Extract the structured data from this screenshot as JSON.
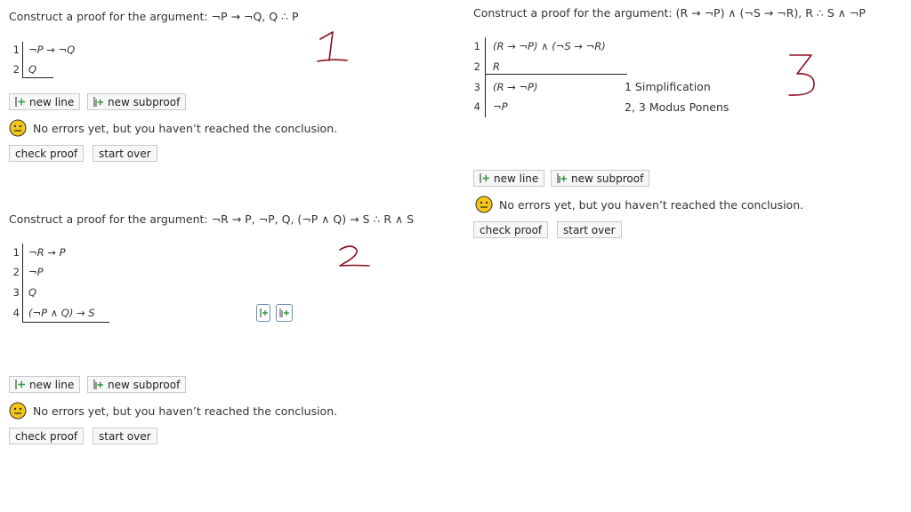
{
  "icons": {
    "new_line": "new-line-icon",
    "new_subproof": "new-subproof-icon",
    "status": "neutral-face-icon"
  },
  "colors": {
    "handwriting": "#8b0f1e",
    "face": "#f5c518",
    "insert_green": "#2e9a3c"
  },
  "problems": [
    {
      "prompt": "Construct a proof for the argument: ¬P → ¬Q, Q ∴ P",
      "lines": [
        {
          "n": "1",
          "f": "¬P → ¬Q",
          "just": ""
        },
        {
          "n": "2",
          "f": "Q",
          "just": ""
        }
      ],
      "new_line_label": "new line",
      "new_subproof_label": "new subproof",
      "status": "No errors yet, but you haven’t reached the conclusion.",
      "check_label": "check proof",
      "start_over_label": "start over",
      "annotation": "1"
    },
    {
      "prompt": "Construct a proof for the argument: ¬R → P, ¬P, Q, (¬P ∧ Q) → S ∴ R ∧ S",
      "lines": [
        {
          "n": "1",
          "f": "¬R → P",
          "just": ""
        },
        {
          "n": "2",
          "f": "¬P",
          "just": ""
        },
        {
          "n": "3",
          "f": "Q",
          "just": ""
        },
        {
          "n": "4",
          "f": "(¬P ∧ Q) → S",
          "just": ""
        }
      ],
      "new_line_label": "new line",
      "new_subproof_label": "new subproof",
      "status": "No errors yet, but you haven’t reached the conclusion.",
      "check_label": "check proof",
      "start_over_label": "start over",
      "annotation": "2"
    },
    {
      "prompt": "Construct a proof for the argument: (R → ¬P) ∧ (¬S → ¬R), R ∴ S ∧ ¬P",
      "lines": [
        {
          "n": "1",
          "f": "(R → ¬P) ∧ (¬S → ¬R)",
          "just": ""
        },
        {
          "n": "2",
          "f": "R",
          "just": ""
        },
        {
          "n": "3",
          "f": "(R → ¬P)",
          "just": "1 Simplification"
        },
        {
          "n": "4",
          "f": "¬P",
          "just": "2, 3 Modus Ponens"
        }
      ],
      "new_line_label": "new line",
      "new_subproof_label": "new subproof",
      "status": "No errors yet, but you haven’t reached the conclusion.",
      "check_label": "check proof",
      "start_over_label": "start over",
      "annotation": "3"
    }
  ]
}
